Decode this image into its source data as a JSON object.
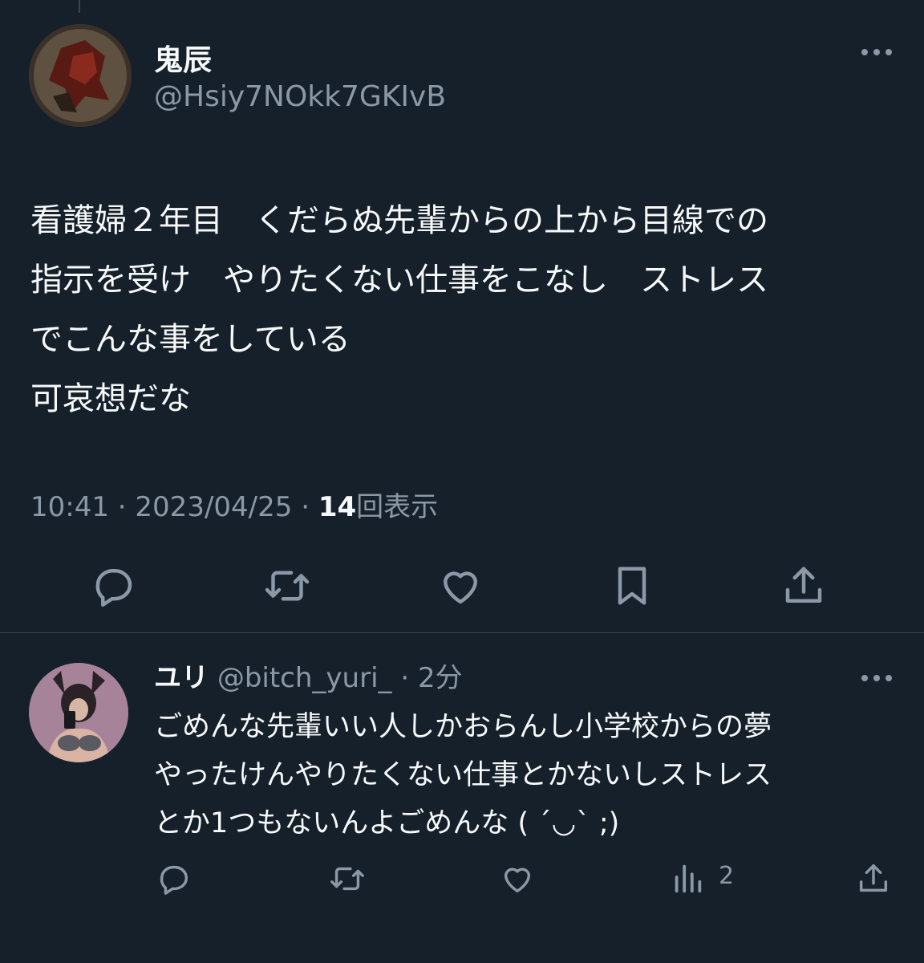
{
  "main_tweet": {
    "author_name": "鬼辰",
    "author_handle": "@Hsiy7NOkk7GKIvB",
    "text": "看護婦２年目　くだらぬ先輩からの上から目線での\n指示を受け　やりたくない仕事をこなし　ストレス\nでこんな事をしている\n可哀想だな",
    "time": "10:41",
    "separator": "·",
    "date": "2023/04/25",
    "views_count": "14",
    "views_label": "回表示",
    "more_icon": "more-horizontal-icon",
    "actions": [
      "reply-icon",
      "retweet-icon",
      "like-icon",
      "bookmark-icon",
      "share-icon"
    ]
  },
  "reply_tweet": {
    "author_name": "ユリ",
    "author_handle": "@bitch_yuri_",
    "separator": "·",
    "time": "2分",
    "text": "ごめんな先輩いい人しかおらんし小学校からの夢\nやったけんやりたくない仕事とかないしストレス\nとか1つもないんよごめんな ( ´◡` ;)",
    "views_count": "2",
    "more_icon": "more-horizontal-icon",
    "actions": [
      "reply-icon",
      "retweet-icon",
      "like-icon",
      "views-icon",
      "share-icon"
    ]
  },
  "colors": {
    "background": "#15202b",
    "text_primary": "#f7f9f9",
    "text_secondary": "#8b98a5",
    "divider": "#38444d"
  }
}
